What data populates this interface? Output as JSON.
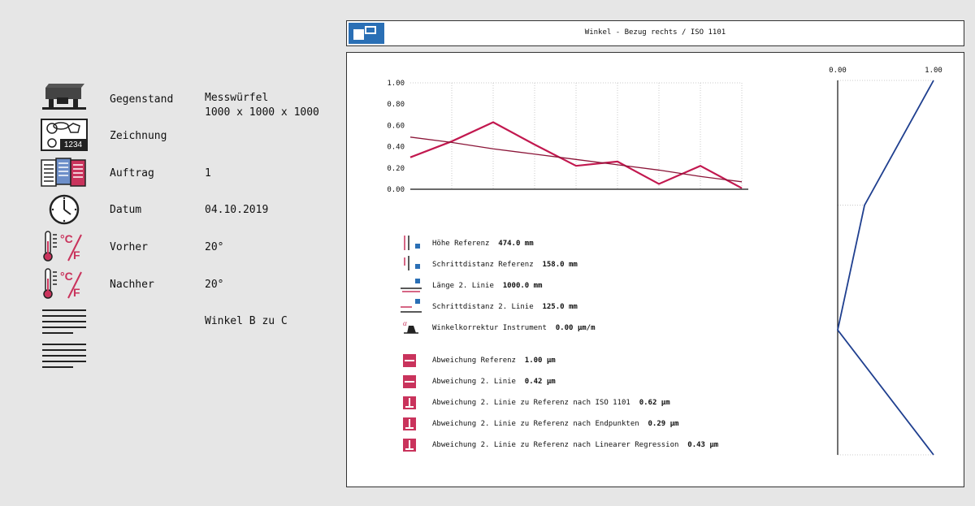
{
  "info": {
    "gegenstand": {
      "label": "Gegenstand",
      "value": "Messwürfel\n1000 x 1000 x 1000"
    },
    "zeichnung": {
      "label": "Zeichnung",
      "badge": "1234"
    },
    "auftrag": {
      "label": "Auftrag",
      "value": "1"
    },
    "datum": {
      "label": "Datum",
      "value": "04.10.2019"
    },
    "vorher": {
      "label": "Vorher",
      "value": "20°"
    },
    "nachher": {
      "label": "Nachher",
      "value": "20°"
    },
    "bemerkung": {
      "value": "Winkel B zu C"
    },
    "temp_unit": "°C/F"
  },
  "window": {
    "title": "Winkel - Bezug rechts / ISO 1101"
  },
  "params": [
    {
      "text": "Höhe Referenz",
      "value": "474.0 mm"
    },
    {
      "text": "Schrittdistanz Referenz",
      "value": "158.0 mm"
    },
    {
      "text": "Länge 2. Linie",
      "value": "1000.0 mm"
    },
    {
      "text": "Schrittdistanz 2. Linie",
      "value": "125.0 mm"
    },
    {
      "text": "Winkelkorrektur Instrument",
      "value": "0.00 µm/m"
    }
  ],
  "deviations": [
    {
      "text": "Abweichung Referenz",
      "value": "1.00 µm"
    },
    {
      "text": "Abweichung 2. Linie",
      "value": "0.42 µm"
    },
    {
      "text": "Abweichung 2. Linie zu Referenz nach ISO 1101",
      "value": "0.62 µm"
    },
    {
      "text": "Abweichung 2. Linie zu Referenz nach Endpunkten",
      "value": "0.29 µm"
    },
    {
      "text": "Abweichung 2. Linie zu Referenz nach Linearer Regression",
      "value": "0.43 µm"
    }
  ],
  "colors": {
    "series_line": "#c2184f",
    "regression": "#8b1538",
    "reference": "#1f3f8f",
    "icon_blue": "#2a6fb5"
  },
  "chart_data": [
    {
      "type": "line",
      "name": "2. Linie",
      "x": [
        0,
        1,
        2,
        3,
        4,
        5,
        6,
        7,
        8
      ],
      "series": [
        {
          "values": [
            0.3,
            0.45,
            0.63,
            0.42,
            0.22,
            0.26,
            0.05,
            0.22,
            0.01
          ]
        },
        {
          "values": [
            0.49,
            0.44,
            0.38,
            0.33,
            0.28,
            0.23,
            0.18,
            0.12,
            0.07
          ],
          "style": "regression"
        }
      ],
      "yticks": [
        "1.00",
        "0.80",
        "0.60",
        "0.40",
        "0.20",
        "0.00"
      ],
      "ylim": [
        0,
        1
      ],
      "grid": true
    },
    {
      "type": "line",
      "name": "Referenz",
      "orientation": "vertical",
      "xticks": [
        "0.00",
        "1.00"
      ],
      "xlim": [
        0,
        1
      ],
      "position": [
        0,
        1,
        2,
        3
      ],
      "values": [
        1.0,
        0.28,
        0.0,
        1.0
      ]
    }
  ]
}
